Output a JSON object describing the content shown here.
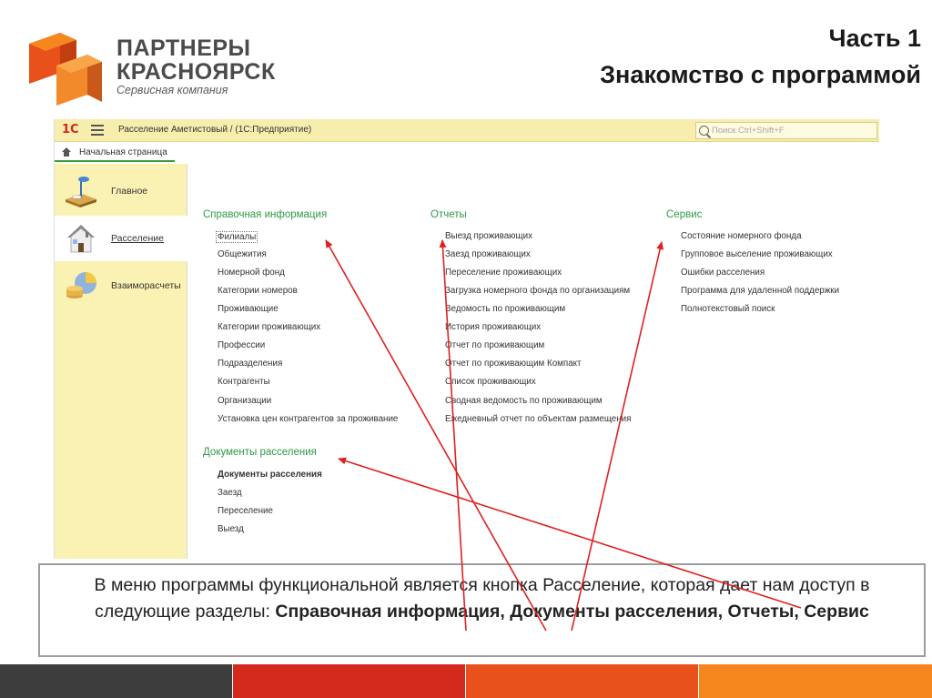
{
  "logo": {
    "title_line1": "ПАРТНЕРЫ",
    "title_line2": "КРАСНОЯРСК",
    "subtitle": "Сервисная компания"
  },
  "slide": {
    "title_line1": "Часть 1",
    "title_line2": "Знакомство с программой"
  },
  "app": {
    "logo_text": "1С",
    "window_title": "Расселение Аметистовый /   (1С:Предприятие)",
    "search_placeholder": "Поиск Ctrl+Shift+F",
    "home_tab": "Начальная страница"
  },
  "sidebar": {
    "items": [
      {
        "label": "Главное",
        "icon": "desk-lamp-icon",
        "active": false
      },
      {
        "label": "Расселение",
        "icon": "house-icon",
        "active": true
      },
      {
        "label": "Взаиморасчеты",
        "icon": "coins-chart-icon",
        "active": false
      }
    ]
  },
  "sections": {
    "reference": {
      "title": "Справочная информация",
      "items": [
        "Филиалы",
        "Общежития",
        "Номерной фонд",
        "Категории номеров",
        "Проживающие",
        "Категории проживающих",
        "Профессии",
        "Подразделения",
        "Контрагенты",
        "Организации",
        "Установка цен контрагентов за проживание"
      ]
    },
    "documents": {
      "title": "Документы расселения",
      "items": [
        "Документы расселения",
        "Заезд",
        "Переселение",
        "Выезд"
      ]
    },
    "reports": {
      "title": "Отчеты",
      "items": [
        "Выезд проживающих",
        "Заезд проживающих",
        "Переселение проживающих",
        "Загрузка номерного фонда по организациям",
        "Ведомость по проживающим",
        "История проживающих",
        "Отчет по проживающим",
        "Отчет по проживающим Компакт",
        "Список проживающих",
        "Сводная ведомость по проживающим",
        "Ежедневный отчет по объектам размещения"
      ]
    },
    "service": {
      "title": "Сервис",
      "items": [
        "Состояние номерного фонда",
        "Групповое выселение проживающих",
        "Ошибки расселения",
        "Программа для удаленной поддержки",
        "Полнотекстовый поиск"
      ]
    }
  },
  "caption": {
    "text_plain": "В меню программы функциональной является кнопка Расселение, которая дает нам доступ в следующие разделы: ",
    "text_bold": "Справочная информация, Документы расселения, Отчеты, Сервис"
  },
  "colors": {
    "accent_yellow": "#f7eeae",
    "section_green": "#2e9a45",
    "arrow_red": "#e02020",
    "stripe_dark": "#3d3d3d",
    "stripe_red": "#d42a1e",
    "stripe_orange_red": "#e8501c",
    "stripe_orange": "#f6861e"
  }
}
